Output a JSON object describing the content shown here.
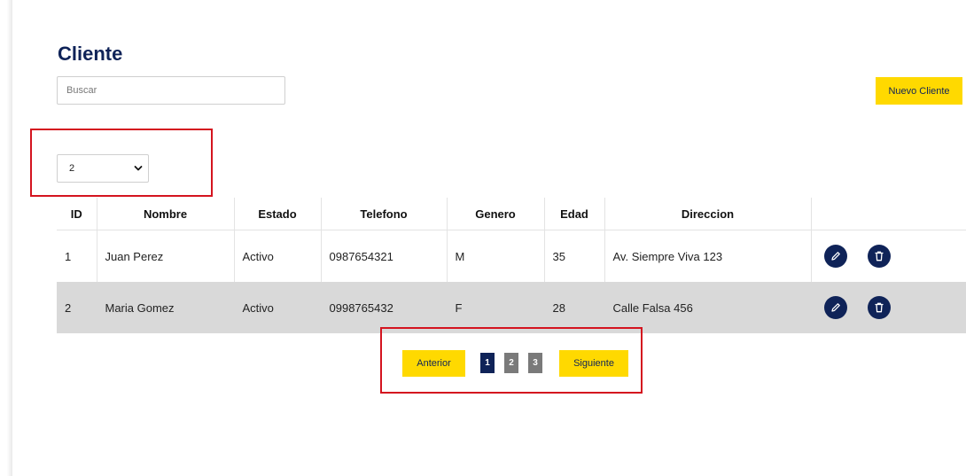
{
  "page": {
    "title": "Cliente"
  },
  "search": {
    "placeholder": "Buscar",
    "value": ""
  },
  "toolbar": {
    "new_client_label": "Nuevo Cliente"
  },
  "page_size_select": {
    "selected": "2"
  },
  "table": {
    "headers": [
      "ID",
      "Nombre",
      "Estado",
      "Telefono",
      "Genero",
      "Edad",
      "Direccion",
      ""
    ],
    "rows": [
      {
        "id": "1",
        "nombre": "Juan Perez",
        "estado": "Activo",
        "telefono": "0987654321",
        "genero": "M",
        "edad": "35",
        "direccion": "Av. Siempre Viva 123"
      },
      {
        "id": "2",
        "nombre": "Maria Gomez",
        "estado": "Activo",
        "telefono": "0998765432",
        "genero": "F",
        "edad": "28",
        "direccion": "Calle Falsa 456"
      }
    ],
    "row_actions": [
      "pencil-icon",
      "trash-icon"
    ]
  },
  "pagination": {
    "prev_label": "Anterior",
    "next_label": "Siguiente",
    "pages": [
      "1",
      "2",
      "3"
    ],
    "current_page": "1"
  },
  "colors": {
    "brand_navy": "#0f2358",
    "accent_yellow": "#ffd900",
    "highlight_red": "#d4141f",
    "page_inactive": "#7a7a7a",
    "row_alt_bg": "#d9d9d9"
  }
}
